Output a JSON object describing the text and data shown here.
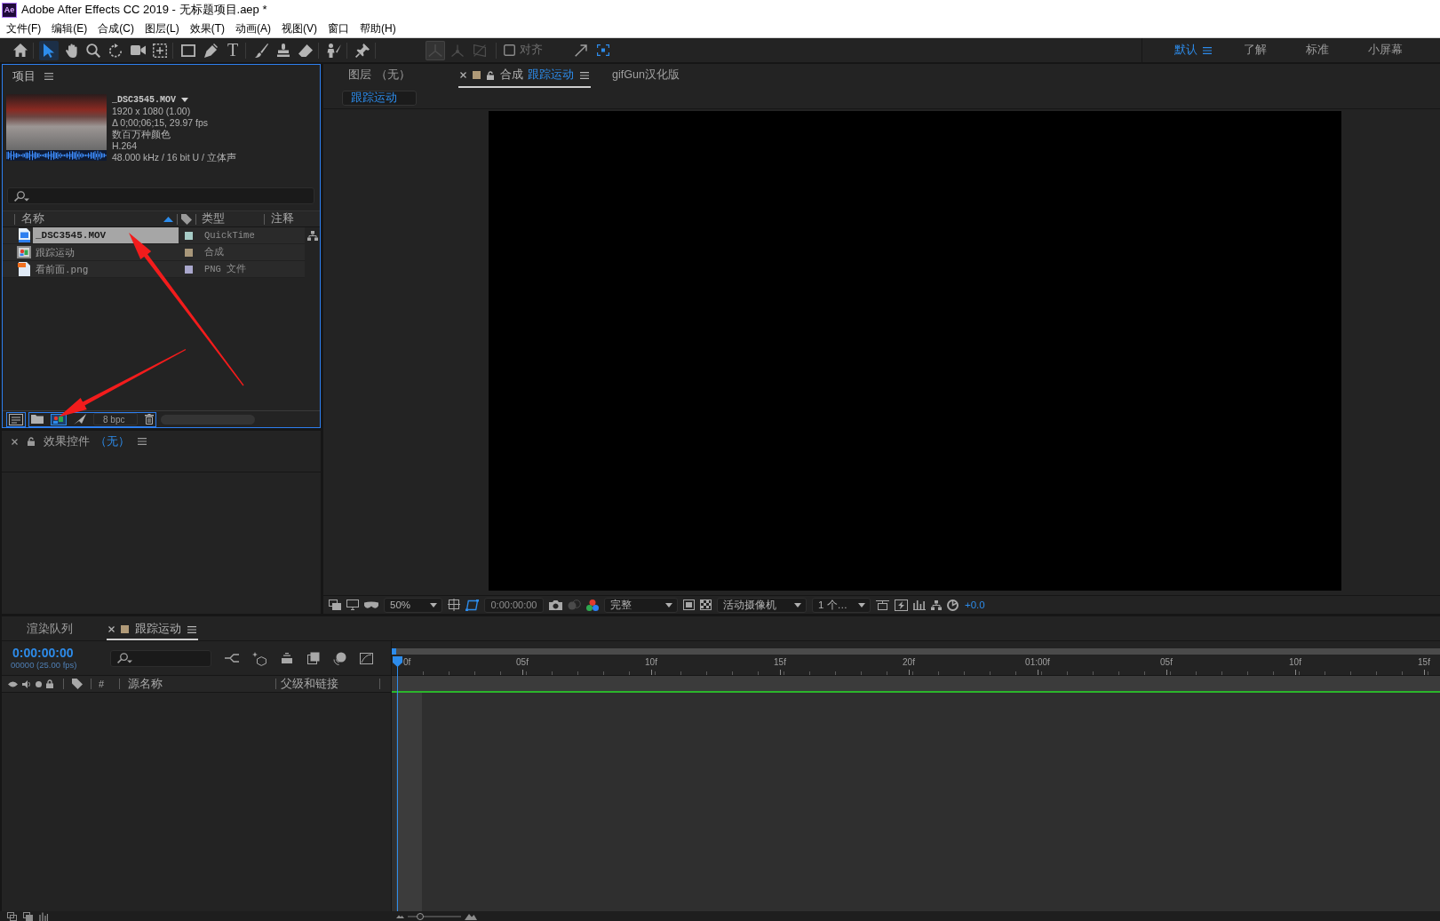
{
  "window": {
    "app_badge": "Ae",
    "title": "Adobe After Effects CC 2019 - 无标题项目.aep *"
  },
  "menu": [
    "文件(F)",
    "编辑(E)",
    "合成(C)",
    "图层(L)",
    "效果(T)",
    "动画(A)",
    "视图(V)",
    "窗口",
    "帮助(H)"
  ],
  "toolbar": {
    "tools": [
      {
        "kind": "home",
        "selected": false
      },
      {
        "kind": "selection",
        "selected": true
      },
      {
        "kind": "hand",
        "selected": false
      },
      {
        "kind": "zoom",
        "selected": false
      },
      {
        "kind": "rotation",
        "selected": false
      },
      {
        "kind": "camera",
        "selected": false
      },
      {
        "kind": "pan",
        "selected": false
      },
      {
        "kind": "rectangle",
        "selected": false
      },
      {
        "kind": "pen",
        "selected": false
      },
      {
        "kind": "type",
        "glyph": "T",
        "selected": false
      },
      {
        "kind": "brush",
        "selected": false
      },
      {
        "kind": "stamp",
        "selected": false
      },
      {
        "kind": "eraser",
        "selected": false
      },
      {
        "kind": "roto",
        "selected": false
      },
      {
        "kind": "puppet",
        "selected": false
      }
    ],
    "axis_modes": [
      {
        "selected": true,
        "disabled": true
      },
      {
        "selected": false,
        "disabled": true
      },
      {
        "selected": false,
        "disabled": true
      }
    ],
    "snapping": {
      "label": "对齐",
      "checked": false
    },
    "workspaces": [
      {
        "label": "默认",
        "selected": true
      },
      {
        "label": "了解",
        "selected": false
      },
      {
        "label": "标准",
        "selected": false
      },
      {
        "label": "小屏幕",
        "selected": false
      }
    ]
  },
  "project": {
    "title": "项目",
    "focused": true,
    "preview": {
      "name": "_DSC3545.MOV",
      "details": [
        "1920 x 1080 (1.00)",
        "Δ 0;00;06;15, 29.97 fps",
        "数百万种颜色",
        "H.264",
        "48.000 kHz / 16 bit U / 立体声"
      ]
    },
    "columns": [
      "名称",
      "类型",
      "注释"
    ],
    "items": [
      {
        "kind": "footage",
        "name": "_DSC3545.MOV",
        "type": "QuickTime",
        "color": "#a6cbc6",
        "selected": true,
        "marked": true
      },
      {
        "kind": "composition",
        "name": "跟踪运动",
        "type": "合成",
        "color": "#a8977a",
        "selected": false,
        "marked": false
      },
      {
        "kind": "image",
        "name": "看前面.png",
        "type": "PNG 文件",
        "color": "#a9a7cc",
        "selected": false,
        "marked": false
      }
    ],
    "footer_groups": [
      {
        "outlined": true,
        "buttons": [
          {
            "kind": "interpret",
            "marked": false
          }
        ]
      },
      {
        "outlined": true,
        "buttons": [
          {
            "kind": "folder",
            "marked": false
          },
          {
            "kind": "composition",
            "marked": true
          },
          {
            "kind": "flowchart",
            "marked": false
          },
          {
            "kind": "bit-depth",
            "label": "8 bpc",
            "marked": false
          },
          {
            "kind": "trash",
            "marked": false
          }
        ]
      }
    ]
  },
  "effects": {
    "title": "效果控件",
    "subject": "（无）"
  },
  "viewer": {
    "tabs": [
      {
        "kind": "layer",
        "label": "图层",
        "subject": "（无）",
        "selected": false
      },
      {
        "kind": "composition",
        "label": "合成",
        "subject": "跟踪运动",
        "selected": true
      },
      {
        "kind": "panel",
        "label": "gifGun汉化版",
        "selected": false
      }
    ],
    "breadcrumb": "跟踪运动",
    "controls": {
      "magnification": "50%",
      "timecode": "0:00:00:00",
      "resolution": "完整",
      "camera": "活动摄像机",
      "views": "1 个…",
      "exposure": "+0.0"
    }
  },
  "timeline": {
    "tabs": [
      {
        "kind": "panel",
        "label": "渲染队列",
        "selected": false
      },
      {
        "kind": "composition",
        "label": "跟踪运动",
        "selected": true
      }
    ],
    "timecode": "0:00:00:00",
    "frame_info": "00000 (25.00 fps)",
    "columns": [
      "#",
      "源名称",
      "父级和链接"
    ],
    "ruler": [
      "0f",
      "05f",
      "10f",
      "15f",
      "20f",
      "01:00f",
      "05f",
      "10f",
      "15f"
    ],
    "playhead": {
      "level": 0
    }
  },
  "status_bar": {
    "zoom_slider": {
      "level": 0.2
    }
  }
}
